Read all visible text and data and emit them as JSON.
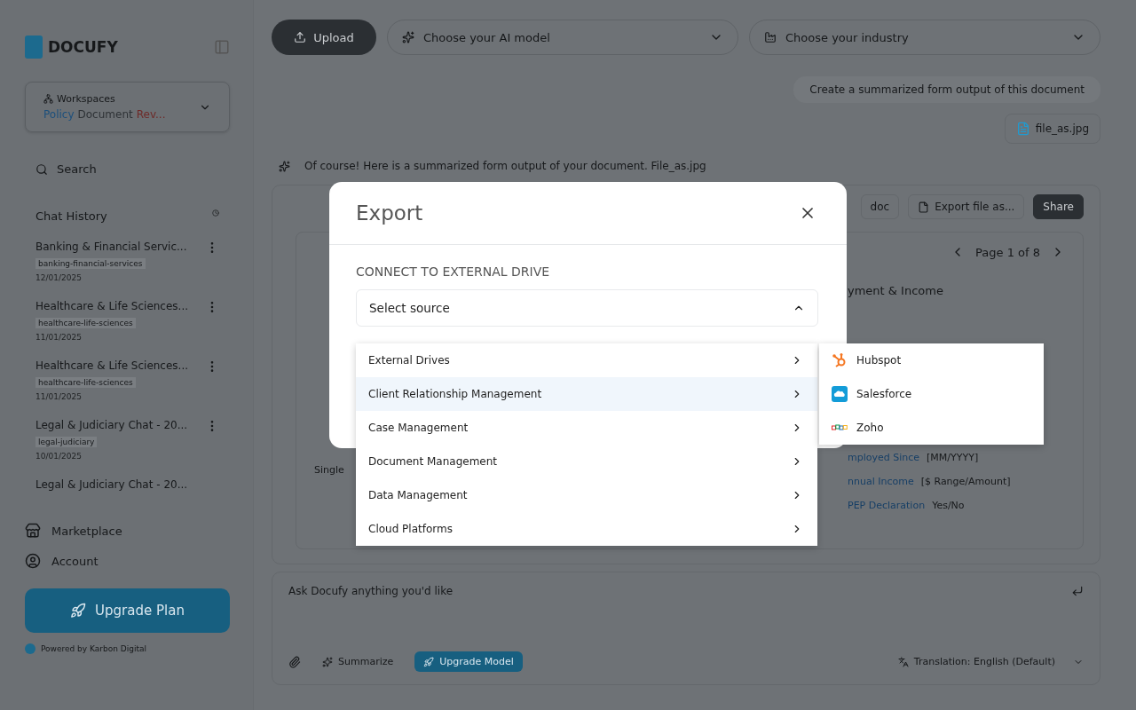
{
  "sidebar": {
    "brand": "DOCUFY",
    "workspace": {
      "label": "Workspaces",
      "name_parts": [
        {
          "text": "Policy",
          "color": "#1c4f7c"
        },
        {
          "text": "Document",
          "color": "#2e3236"
        },
        {
          "text": "Rev...",
          "color": "#6e2a28"
        }
      ]
    },
    "search": {
      "placeholder": "Search"
    },
    "history_title": "Chat History",
    "chats": [
      {
        "title": "Banking & Financial Servic...",
        "tag": "banking-financial-services",
        "date": "12/01/2025"
      },
      {
        "title": "Healthcare & Life Sciences...",
        "tag": "healthcare-life-sciences",
        "date": "11/01/2025"
      },
      {
        "title": "Healthcare & Life Sciences...",
        "tag": "healthcare-life-sciences",
        "date": "11/01/2025"
      },
      {
        "title": "Legal & Judiciary Chat - 20...",
        "tag": "legal-judiciary",
        "date": "10/01/2025"
      },
      {
        "title": "Legal & Judiciary Chat - 20..."
      }
    ],
    "nav": [
      {
        "label": "Marketplace",
        "kind": "store"
      },
      {
        "label": "Account",
        "kind": "account"
      }
    ],
    "upgrade": "Upgrade Plan",
    "powered": "Powered by Karbon Digital"
  },
  "toolbar": {
    "upload": "Upload",
    "model_placeholder": "Choose your AI model",
    "industry_placeholder": "Choose your industry"
  },
  "chat": {
    "user_message": "Create a summarized form output of this document",
    "attachment": "file_as.jpg",
    "reply": "Of course! Here is a summarized form output of your document. File_as.jpg",
    "doc_actions": [
      "doc",
      "Export file as...",
      "Share"
    ],
    "pager": "Page 1 of 8",
    "section_fragment": "yment & Income",
    "left_value": "Single",
    "fields": [
      {
        "label": "mployed Since",
        "value": "[MM/YYYY]"
      },
      {
        "label": "nnual Income",
        "value": "[$ Range/Amount]"
      },
      {
        "label": "PEP Declaration",
        "value": "Yes/No"
      }
    ]
  },
  "composer": {
    "placeholder": "Ask Docufy anything you'd like",
    "summarize": "Summarize",
    "upgrade_model": "Upgrade Model",
    "translation": "Translation: English (Default)"
  },
  "modal": {
    "title": "Export",
    "section": "CONNECT TO EXTERNAL DRIVE",
    "source_select": {
      "value": "Select source",
      "expanded": true
    },
    "categories": [
      {
        "label": "External Drives",
        "selected": false
      },
      {
        "label": "Client Relationship Management",
        "selected": true
      },
      {
        "label": "Case Management",
        "selected": false
      },
      {
        "label": "Document Management",
        "selected": false
      },
      {
        "label": "Data Management",
        "selected": false
      },
      {
        "label": "Cloud Platforms",
        "selected": false
      }
    ],
    "providers": [
      {
        "label": "Hubspot",
        "kind": "sprocket"
      },
      {
        "label": "Salesforce",
        "kind": "cloud"
      },
      {
        "label": "Zoho",
        "kind": "rings"
      }
    ]
  }
}
